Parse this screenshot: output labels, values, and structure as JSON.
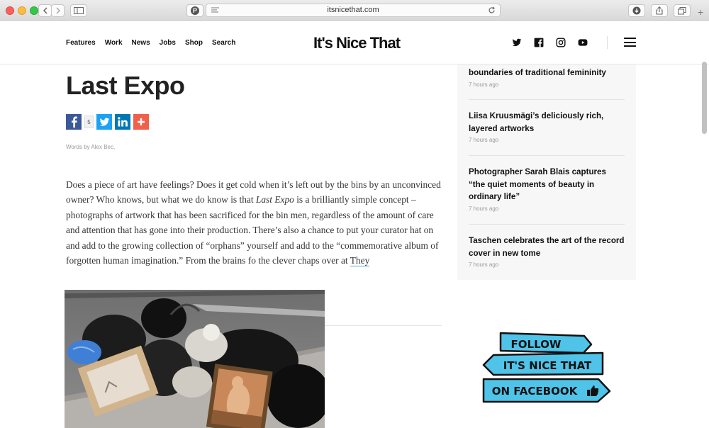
{
  "browser": {
    "url": "itsnicethat.com",
    "pinterest_glyph": "P"
  },
  "header": {
    "nav": [
      "Features",
      "Work",
      "News",
      "Jobs",
      "Shop",
      "Search"
    ],
    "logo": "It's Nice That",
    "social_icons": [
      "twitter-icon",
      "facebook-icon",
      "instagram-icon",
      "youtube-icon"
    ]
  },
  "article": {
    "title": "Last Expo",
    "share_count": "5",
    "byline": "Words by Alex Bec,",
    "body_1": "Does a piece of art have feelings? Does it get cold when it’s left out by the bins by an unconvinced owner? Who knows, but what we do know is that ",
    "body_em": "Last Expo",
    "body_2": " is a brilliantly simple concept – photographs of artwork that has been sacrificed for the bin men, regardless of the amount of care and attention that has gone into their production. There’s also a chance to put your curator hat on and add to the growing collection of “orphans” yourself and add to the “commemorative album of forgotten human imagination.” From the brains fo the clever chaps over at ",
    "body_link": "They"
  },
  "sidebar": {
    "items": [
      {
        "headline": "boundaries of traditional femininity",
        "time": "7 hours ago"
      },
      {
        "headline": "Liisa Kruusmägi’s deliciously rich, layered artworks",
        "time": "7 hours ago"
      },
      {
        "headline": "Photographer Sarah Blais captures “the quiet moments of beauty in ordinary life”",
        "time": "7 hours ago"
      },
      {
        "headline": "Taschen celebrates the art of the record cover in new tome",
        "time": "7 hours ago"
      }
    ]
  },
  "follow_banner": {
    "line1": "FOLLOW",
    "line2": "IT'S NICE THAT",
    "line3": "ON FACEBOOK",
    "color": "#4fc3e8"
  }
}
